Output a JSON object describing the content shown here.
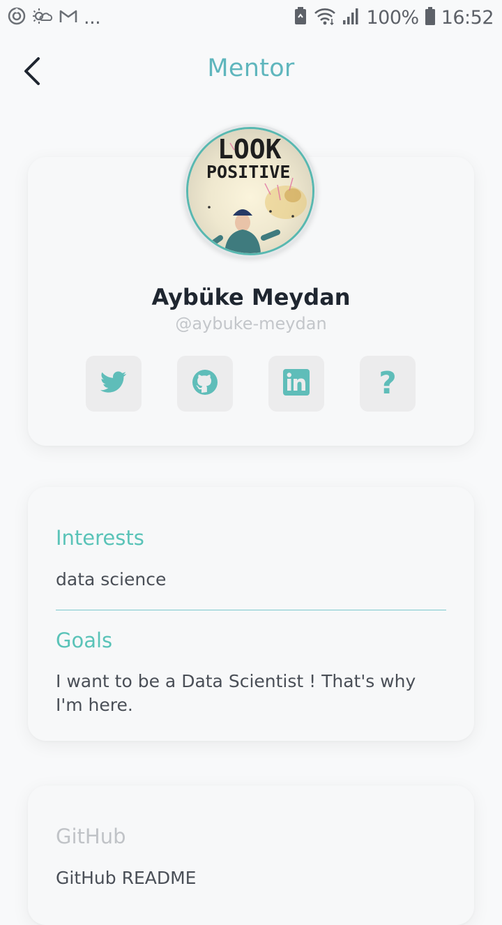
{
  "status_bar": {
    "left_icons": [
      "sync-icon",
      "weather-icon",
      "gmail-icon",
      "more-notifications-icon"
    ],
    "more_label": "...",
    "battery_percent": "100%",
    "time": "16:52"
  },
  "header": {
    "title": "Mentor",
    "back_icon": "chevron-left-icon"
  },
  "profile": {
    "name": "Aybüke Meydan",
    "handle": "@aybuke-meydan",
    "avatar_text_line1": "LOOK",
    "avatar_text_line2": "POSITIVE",
    "social": [
      {
        "icon": "twitter-icon",
        "label": "Twitter"
      },
      {
        "icon": "github-icon",
        "label": "GitHub"
      },
      {
        "icon": "linkedin-icon",
        "label": "LinkedIn"
      },
      {
        "icon": "question-icon",
        "label": "?"
      }
    ]
  },
  "interests": {
    "title": "Interests",
    "text": "data science"
  },
  "goals": {
    "title": "Goals",
    "text": "I want to be a Data Scientist ! That's why I'm here."
  },
  "github": {
    "title": "GitHub",
    "text": "GitHub README"
  },
  "colors": {
    "accent": "#5fb6bd",
    "section_title": "#5ac3b8",
    "social_icon": "#5fbdb9",
    "avatar_border": "#58b8b0"
  }
}
